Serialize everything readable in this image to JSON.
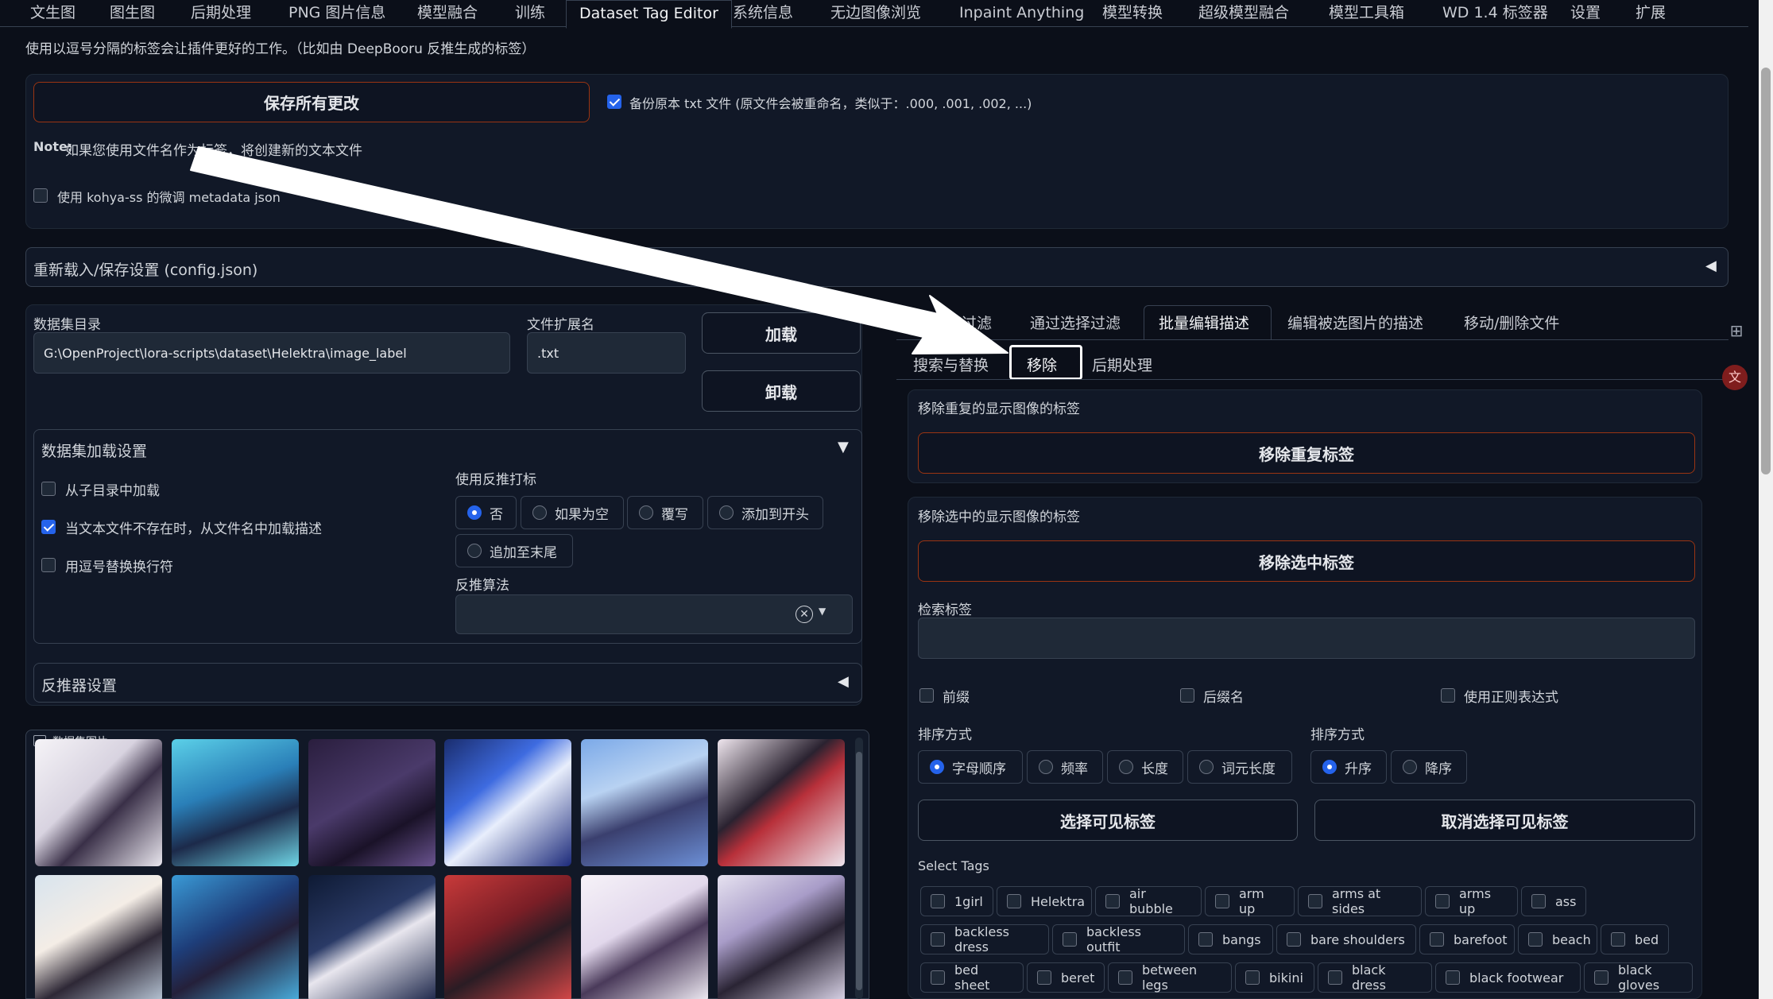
{
  "top_tabs": [
    {
      "label": "文生图"
    },
    {
      "label": "图生图"
    },
    {
      "label": "后期处理"
    },
    {
      "label": "PNG 图片信息"
    },
    {
      "label": "模型融合"
    },
    {
      "label": "训练"
    },
    {
      "label": "Dataset Tag Editor"
    },
    {
      "label": "系统信息"
    },
    {
      "label": "无边图像浏览"
    },
    {
      "label": "Inpaint Anything"
    },
    {
      "label": "模型转换"
    },
    {
      "label": "超级模型融合"
    },
    {
      "label": "模型工具箱"
    },
    {
      "label": "WD 1.4 标签器"
    },
    {
      "label": "设置"
    },
    {
      "label": "扩展"
    }
  ],
  "intro_text": "使用以逗号分隔的标签会让插件更好的工作。（比如由 DeepBooru 反推生成的标签）",
  "save_all_button": "保存所有更改",
  "backup_checkbox": "备份原本 txt 文件 (原文件会被重命名，类似于：.000, .001, .002, ...)",
  "note_label": "Note:",
  "note_text": "如果您使用文件名作为标签，将创建新的文本文件",
  "kohya_checkbox": "使用 kohya-ss 的微调 metadata json",
  "reload_section": "重新载入/保存设置 (config.json)",
  "dataset_dir": {
    "label": "数据集目录",
    "value": "G:\\OpenProject\\lora-scripts\\dataset\\Helektra\\image_label"
  },
  "file_ext": {
    "label": "文件扩展名",
    "value": ".txt"
  },
  "load_button": "加载",
  "unload_button": "卸载",
  "load_settings": {
    "title": "数据集加载设置",
    "checkboxes": [
      {
        "label": "从子目录中加载",
        "checked": false
      },
      {
        "label": "当文本文件不存在时，从文件名中加载描述",
        "checked": true
      },
      {
        "label": "用逗号替换换行符",
        "checked": false
      }
    ],
    "interrogator_label": "使用反推打标",
    "interrogator_options": [
      {
        "label": "否",
        "selected": true
      },
      {
        "label": "如果为空",
        "selected": false
      },
      {
        "label": "覆写",
        "selected": false
      },
      {
        "label": "添加到开头",
        "selected": false
      },
      {
        "label": "追加至末尾",
        "selected": false
      }
    ],
    "algorithm_label": "反推算法"
  },
  "interrogator_settings": "反推器设置",
  "gallery_label": "数据集图片",
  "right_tabs": [
    {
      "label": "通过标签过滤"
    },
    {
      "label": "通过选择过滤"
    },
    {
      "label": "批量编辑描述"
    },
    {
      "label": "编辑被选图片的描述"
    },
    {
      "label": "移动/删除文件"
    }
  ],
  "sub_tabs": [
    {
      "label": "搜索与替换"
    },
    {
      "label": "移除"
    },
    {
      "label": "后期处理"
    }
  ],
  "remove_dup": {
    "label": "移除重复的显示图像的标签",
    "button": "移除重复标签"
  },
  "remove_sel": {
    "label": "移除选中的显示图像的标签",
    "button": "移除选中标签"
  },
  "search_tags_label": "检索标签",
  "search_options": [
    {
      "label": "前缀",
      "checked": false
    },
    {
      "label": "后缀名",
      "checked": false
    },
    {
      "label": "使用正则表达式",
      "checked": false
    }
  ],
  "sort_by": {
    "label": "排序方式",
    "options": [
      {
        "label": "字母顺序",
        "selected": true
      },
      {
        "label": "频率",
        "selected": false
      },
      {
        "label": "长度",
        "selected": false
      },
      {
        "label": "词元长度",
        "selected": false
      }
    ]
  },
  "sort_order": {
    "label": "排序方式",
    "options": [
      {
        "label": "升序",
        "selected": true
      },
      {
        "label": "降序",
        "selected": false
      }
    ]
  },
  "select_visible_button": "选择可见标签",
  "deselect_visible_button": "取消选择可见标签",
  "select_tags_label": "Select Tags",
  "tags": [
    "1girl",
    "Helektra",
    "air bubble",
    "arm up",
    "arms at sides",
    "arms up",
    "ass",
    "backless dress",
    "backless outfit",
    "bangs",
    "bare shoulders",
    "barefoot",
    "beach",
    "bed",
    "bed sheet",
    "beret",
    "between legs",
    "bikini",
    "black dress",
    "black footwear",
    "black gloves"
  ],
  "colors": {
    "bg": "#0b0f19",
    "panel": "#111827",
    "accent": "#2563eb",
    "border": "#374151"
  }
}
